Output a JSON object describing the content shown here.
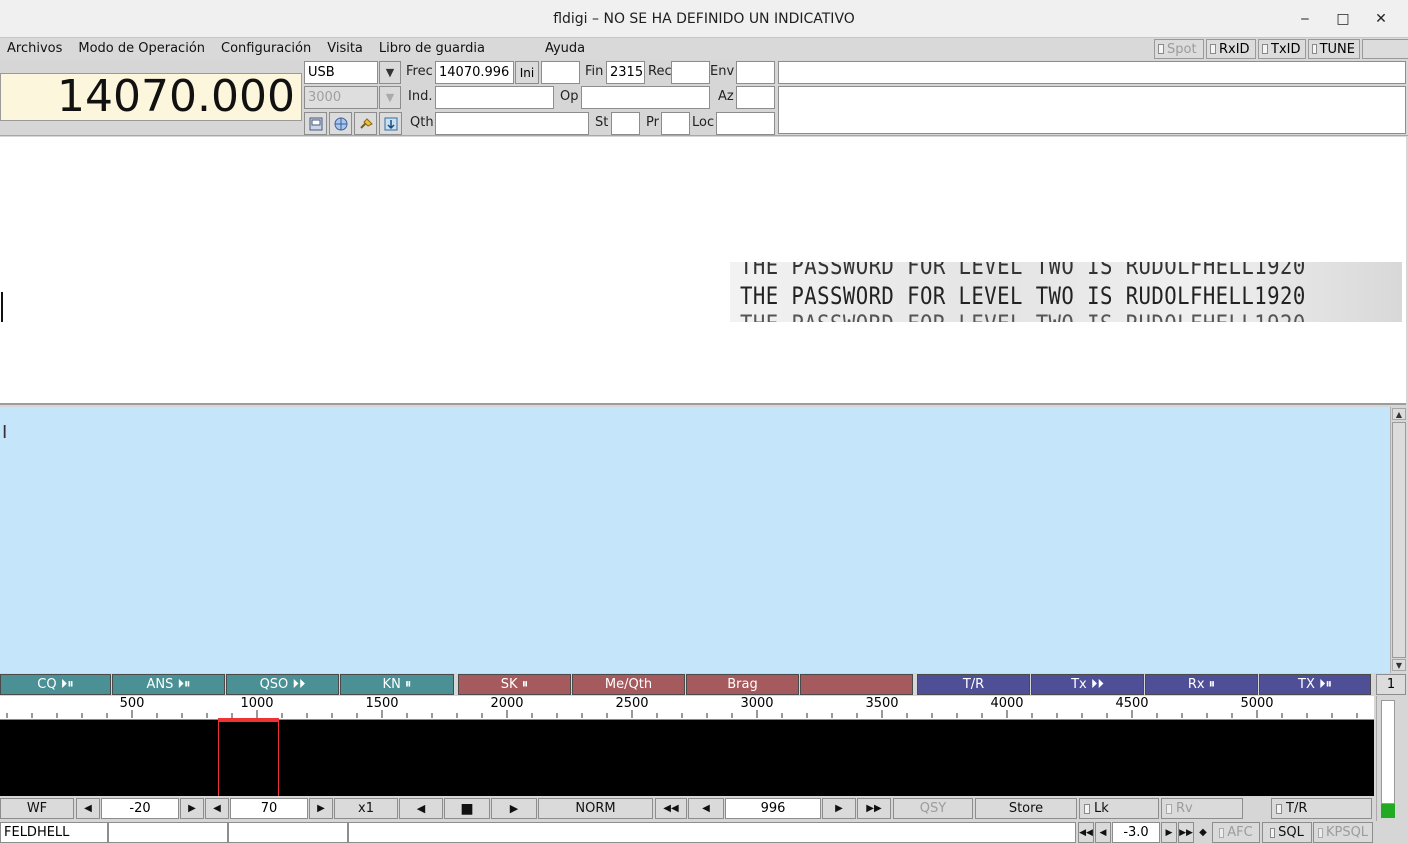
{
  "window": {
    "title": "fldigi – NO SE HA DEFINIDO UN INDICATIVO",
    "minimize": "‒",
    "maximize": "□",
    "close": "✕"
  },
  "menu": {
    "items": [
      "Archivos",
      "Modo de Operación",
      "Configuración",
      "Visita",
      "Libro de guardia",
      "Ayuda"
    ],
    "toggles": [
      {
        "label": "Spot",
        "enabled": false
      },
      {
        "label": "RxID",
        "enabled": true
      },
      {
        "label": "TxID",
        "enabled": true
      },
      {
        "label": "TUNE",
        "enabled": true
      }
    ]
  },
  "rig": {
    "frequency": "14070.000",
    "mode": "USB",
    "bandwidth": "3000"
  },
  "log": {
    "frec_label": "Frec",
    "frec_value": "14070.996",
    "ini_label": "Ini",
    "ini_value": "",
    "fin_label": "Fin",
    "fin_value": "2315",
    "rec_label": "Rec",
    "rec_value": "",
    "env_label": "Env",
    "env_value": "",
    "ind_label": "Ind.",
    "ind_value": "",
    "op_label": "Op",
    "op_value": "",
    "az_label": "Az",
    "az_value": "",
    "qth_label": "Qth",
    "qth_value": "",
    "st_label": "St",
    "st_value": "",
    "pr_label": "Pr",
    "pr_value": "",
    "loc_label": "Loc",
    "loc_value": "",
    "notes1": "",
    "notes2": ""
  },
  "rx": {
    "hell_lines": [
      "THE PASSWORD FOR LEVEL TWO IS RUDOLFHELL1920",
      "THE PASSWORD FOR LEVEL TWO IS RUDOLFHELL1920",
      "THE PASSWORD FOR LEVEL TWO IS RUDOLFHELL1920"
    ]
  },
  "macros": {
    "buttons": [
      {
        "label": "CQ ⏵⏸",
        "color": "#4a9095"
      },
      {
        "label": "ANS ⏵⏸",
        "color": "#4a9095"
      },
      {
        "label": "QSO ⏵⏵",
        "color": "#4a9095"
      },
      {
        "label": "KN ⏸",
        "color": "#4a9095"
      },
      {
        "label": "SK ⏸",
        "color": "#a55a5d"
      },
      {
        "label": "Me/Qth",
        "color": "#a55a5d"
      },
      {
        "label": "Brag",
        "color": "#a55a5d"
      },
      {
        "label": "",
        "color": "#a55a5d"
      },
      {
        "label": "T/R",
        "color": "#4f4f97"
      },
      {
        "label": "Tx ⏵⏵",
        "color": "#4f4f97"
      },
      {
        "label": "Rx ⏸",
        "color": "#4f4f97"
      },
      {
        "label": "TX ⏵⏸",
        "color": "#4f4f97"
      }
    ],
    "bank": "1"
  },
  "waterfall": {
    "scale": [
      "500",
      "1000",
      "1500",
      "2000",
      "2500",
      "3000",
      "3500",
      "4000",
      "4500",
      "5000"
    ]
  },
  "controls": {
    "wf_label": "WF",
    "reflevel": "-20",
    "ampspan": "70",
    "zoom": "x1",
    "norm": "NORM",
    "carrier": "996",
    "qsy": "QSY",
    "store": "Store",
    "lk": "Lk",
    "rv": "Rv",
    "tr": "T/R"
  },
  "status": {
    "mode": "FELDHELL",
    "field2": "",
    "field3": "",
    "msg": "",
    "offset": "-3.0",
    "afc": "AFC",
    "sql": "SQL",
    "kpsql": "KPSQL"
  }
}
